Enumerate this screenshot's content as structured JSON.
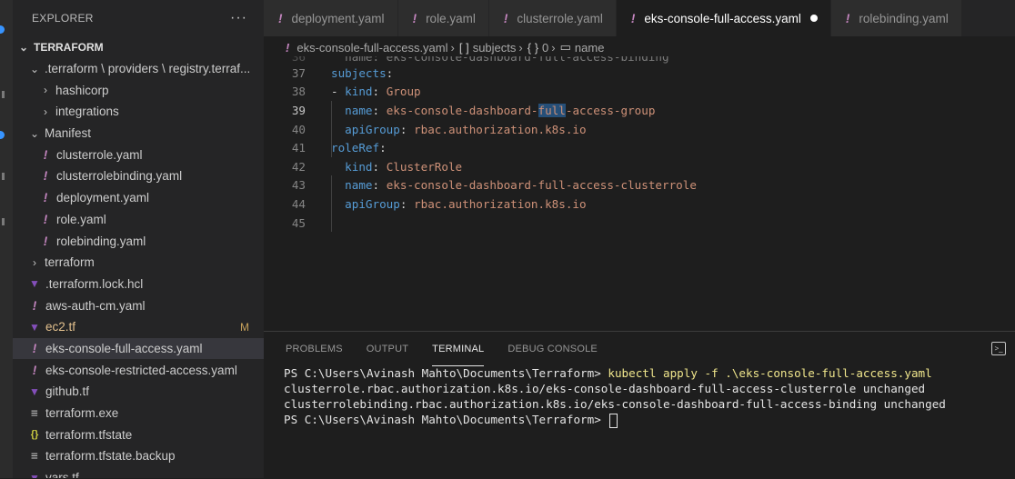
{
  "sidebar": {
    "title": "EXPLORER",
    "more": "···",
    "section": "TERRAFORM",
    "items": [
      {
        "label": ".terraform \\ providers \\ registry.terraf...",
        "indent": 1,
        "chevron": "⌄",
        "icon": ""
      },
      {
        "label": "hashicorp",
        "indent": 2,
        "chevron": "›",
        "icon": ""
      },
      {
        "label": "integrations",
        "indent": 2,
        "chevron": "›",
        "icon": ""
      },
      {
        "label": "Manifest",
        "indent": 1,
        "chevron": "⌄",
        "icon": ""
      },
      {
        "label": "clusterrole.yaml",
        "indent": 2,
        "chevron": "",
        "icon": "!"
      },
      {
        "label": "clusterrolebinding.yaml",
        "indent": 2,
        "chevron": "",
        "icon": "!"
      },
      {
        "label": "deployment.yaml",
        "indent": 2,
        "chevron": "",
        "icon": "!"
      },
      {
        "label": "role.yaml",
        "indent": 2,
        "chevron": "",
        "icon": "!"
      },
      {
        "label": "rolebinding.yaml",
        "indent": 2,
        "chevron": "",
        "icon": "!"
      },
      {
        "label": "terraform",
        "indent": 1,
        "chevron": "›",
        "icon": ""
      },
      {
        "label": ".terraform.lock.hcl",
        "indent": 1,
        "chevron": "",
        "icon": "tf"
      },
      {
        "label": "aws-auth-cm.yaml",
        "indent": 1,
        "chevron": "",
        "icon": "!"
      },
      {
        "label": "ec2.tf",
        "indent": 1,
        "chevron": "",
        "icon": "tf",
        "badge": "M"
      },
      {
        "label": "eks-console-full-access.yaml",
        "indent": 1,
        "chevron": "",
        "icon": "!",
        "selected": true
      },
      {
        "label": "eks-console-restricted-access.yaml",
        "indent": 1,
        "chevron": "",
        "icon": "!"
      },
      {
        "label": "github.tf",
        "indent": 1,
        "chevron": "",
        "icon": "tf"
      },
      {
        "label": "terraform.exe",
        "indent": 1,
        "chevron": "",
        "icon": "≡"
      },
      {
        "label": "terraform.tfstate",
        "indent": 1,
        "chevron": "",
        "icon": "{}"
      },
      {
        "label": "terraform.tfstate.backup",
        "indent": 1,
        "chevron": "",
        "icon": "≡"
      },
      {
        "label": "vars.tf",
        "indent": 1,
        "chevron": "",
        "icon": "tf"
      }
    ]
  },
  "tabs": [
    {
      "label": "deployment.yaml",
      "icon": "!"
    },
    {
      "label": "role.yaml",
      "icon": "!"
    },
    {
      "label": "clusterrole.yaml",
      "icon": "!"
    },
    {
      "label": "eks-console-full-access.yaml",
      "icon": "!",
      "active": true,
      "unsaved": true
    },
    {
      "label": "rolebinding.yaml",
      "icon": "!"
    }
  ],
  "breadcrumb": {
    "file": "eks-console-full-access.yaml",
    "subjects_glyph": "[ ]",
    "subjects": "subjects",
    "index_glyph": "{ }",
    "index": "0",
    "name_glyph": "▭",
    "name": "name"
  },
  "code": {
    "partial_line": {
      "num": "36",
      "text": "  name: eks-console-dashboard-full-access-binding"
    },
    "lines": [
      {
        "num": "37",
        "key": "subjects",
        "indent": "",
        "dash": "",
        "value": ""
      },
      {
        "num": "38",
        "key": "kind",
        "indent": "",
        "dash": "- ",
        "value": "Group"
      },
      {
        "num": "39",
        "key": "name",
        "indent": "  ",
        "dash": "",
        "value": "eks-console-dashboard-full-access-group",
        "current": true,
        "highlight": "full"
      },
      {
        "num": "40",
        "key": "apiGroup",
        "indent": "  ",
        "dash": "",
        "value": "rbac.authorization.k8s.io"
      },
      {
        "num": "41",
        "key": "roleRef",
        "indent": "",
        "dash": "",
        "value": ""
      },
      {
        "num": "42",
        "key": "kind",
        "indent": "  ",
        "dash": "",
        "value": "ClusterRole"
      },
      {
        "num": "43",
        "key": "name",
        "indent": "  ",
        "dash": "",
        "value": "eks-console-dashboard-full-access-clusterrole"
      },
      {
        "num": "44",
        "key": "apiGroup",
        "indent": "  ",
        "dash": "",
        "value": "rbac.authorization.k8s.io"
      },
      {
        "num": "45",
        "key": "",
        "indent": "",
        "dash": "",
        "value": ""
      }
    ]
  },
  "panel": {
    "tabs": [
      "PROBLEMS",
      "OUTPUT",
      "TERMINAL",
      "DEBUG CONSOLE"
    ],
    "active_tab": "TERMINAL",
    "terminal": {
      "prompt": "PS C:\\Users\\Avinash Mahto\\Documents\\Terraform> ",
      "command": "kubectl apply -f .\\eks-console-full-access.yaml",
      "output": [
        "clusterrole.rbac.authorization.k8s.io/eks-console-dashboard-full-access-clusterrole unchanged",
        "clusterrolebinding.rbac.authorization.k8s.io/eks-console-dashboard-full-access-binding unchanged"
      ]
    }
  },
  "colors": {
    "yaml_icon": "#c586c0",
    "terraform_icon": "#844fba",
    "key": "#569cd6",
    "string": "#ce9178",
    "modified": "#e2c08d",
    "selection": "#264f78"
  }
}
